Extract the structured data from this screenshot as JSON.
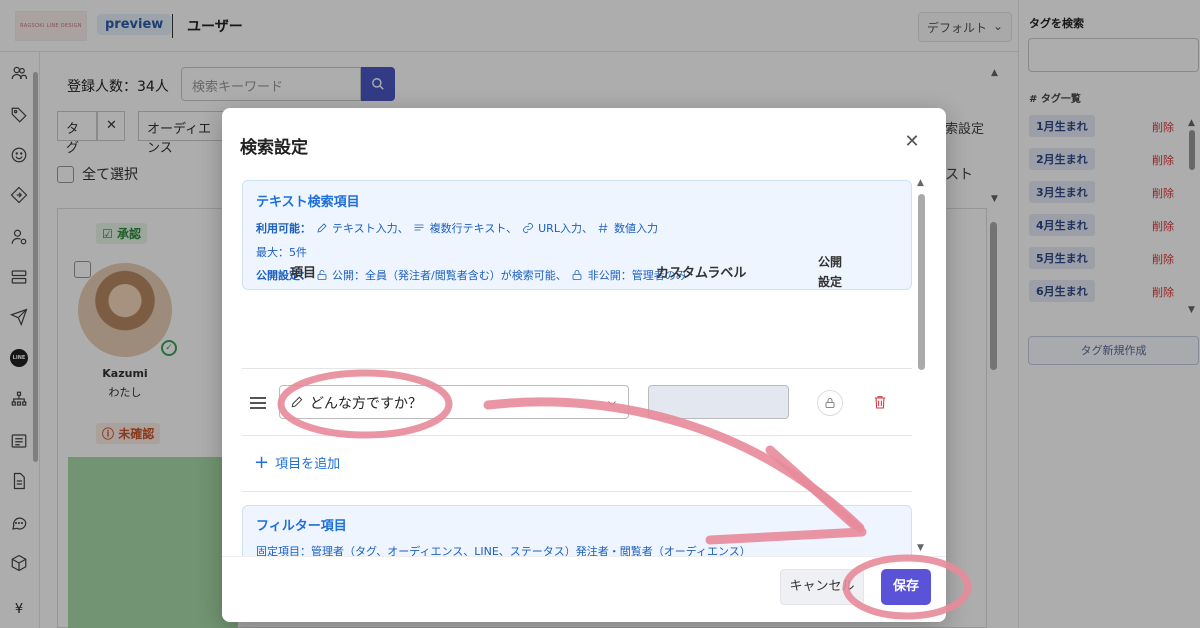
{
  "header": {
    "logo_text": "RAGSOKI LINE DESIGN",
    "preview_badge": "preview",
    "page_title": "ユーザー",
    "default_select": "デフォルト"
  },
  "main": {
    "registered_count": "登録人数：34人",
    "search_placeholder": "検索キーワード",
    "filter_tag": "タグ",
    "filter_tag_clear": "✕",
    "filter_audience": "オーディエンス",
    "select_all": "全て選択",
    "search_settings_fragment": "索設定",
    "list_fragment": "スト",
    "approved_badge": "承認",
    "unconfirmed_badge": "未確認",
    "user_name": "Kazumi",
    "user_sub": "わたし"
  },
  "tag_panel": {
    "search_label": "タグを検索",
    "list_label": "# タグ一覧",
    "delete_label": "削除",
    "tags": [
      "1月生まれ",
      "2月生まれ",
      "3月生まれ",
      "4月生まれ",
      "5月生まれ",
      "6月生まれ"
    ],
    "new_tag_button": "タグ新規作成"
  },
  "modal": {
    "title": "検索設定",
    "text_section": {
      "title": "テキスト検索項目",
      "available_label": "利用可能：",
      "available_items": [
        "テキスト入力、",
        "複数行テキスト、",
        "URL入力、",
        "数値入力"
      ],
      "max_line": "最大：5件",
      "public_label": "公開設定：",
      "public_text": "公開：全員（発注者/閲覧者含む）が検索可能、",
      "private_text": "非公開：管理者のみ"
    },
    "table": {
      "col_item": "項目",
      "col_custom_label": "カスタムラベル",
      "col_public_1": "公開",
      "col_public_2": "設定",
      "row_item_value": "どんな方ですか？",
      "row_custom_label_value": "",
      "add_item": "項目を追加"
    },
    "filter_section": {
      "title": "フィルター項目",
      "fixed_line": "固定項目：管理者（タグ、オーディエンス、LINE、ステータス）発注者・閲覧者（オーディエンス）"
    },
    "cancel_button": "キャンセル",
    "save_button": "保存"
  },
  "colors": {
    "accent": "#5a53d8",
    "info_blue": "#1e6fd9",
    "annotation_pink": "#e8899a"
  }
}
